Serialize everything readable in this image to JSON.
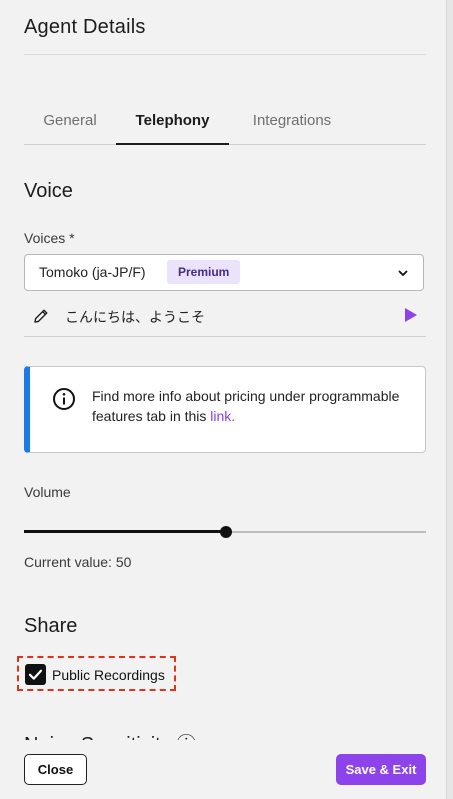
{
  "header": {
    "title": "Agent Details"
  },
  "tabs": [
    {
      "label": "General",
      "active": false
    },
    {
      "label": "Telephony",
      "active": true
    },
    {
      "label": "Integrations",
      "active": false
    }
  ],
  "voice": {
    "section_title": "Voice",
    "field_label": "Voices *",
    "selected_voice": "Tomoko (ja-JP/F)",
    "badge": "Premium",
    "preview_text": "こんにちは、ようこそ"
  },
  "info": {
    "text": "Find more info about pricing under programmable features tab in this",
    "link_text": "link.",
    "accent_color": "#1a7be6"
  },
  "volume": {
    "label": "Volume",
    "value": 50,
    "min": 0,
    "max": 100,
    "current_text": "Current value: 50"
  },
  "share": {
    "section_title": "Share",
    "checkbox_label": "Public Recordings",
    "checked": true
  },
  "next_section": {
    "title": "Noise Sensitivity ⓘ"
  },
  "footer": {
    "close_label": "Close",
    "save_label": "Save & Exit",
    "save_color": "#8d43ea"
  }
}
